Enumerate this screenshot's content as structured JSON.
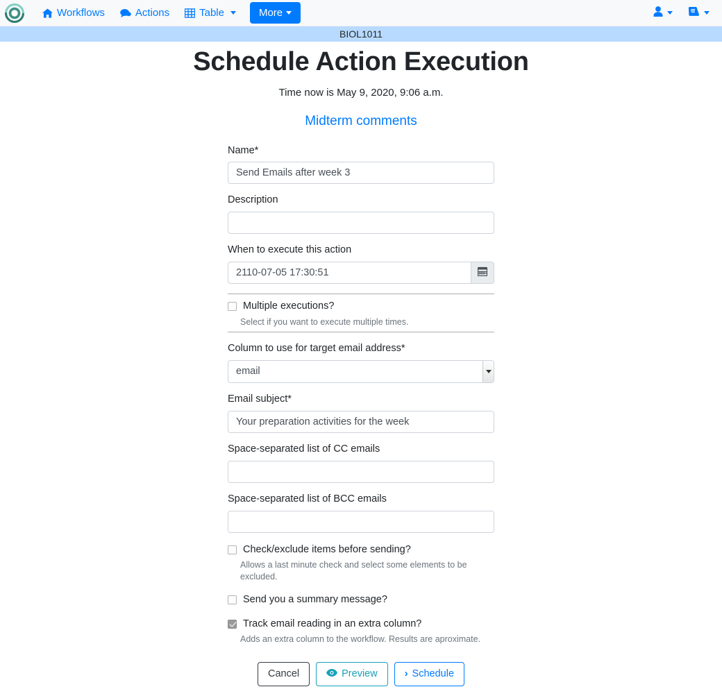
{
  "navbar": {
    "brand_icon": "ontask-logo-icon",
    "links": [
      {
        "label": "Workflows",
        "icon": "home-icon",
        "dropdown": false
      },
      {
        "label": "Actions",
        "icon": "comments-icon",
        "dropdown": false
      },
      {
        "label": "Table",
        "icon": "table-icon",
        "dropdown": true
      }
    ],
    "more_button": {
      "label": "More",
      "dropdown": true
    },
    "right_items": [
      {
        "icon": "user-icon",
        "dropdown": true
      },
      {
        "icon": "book-icon",
        "dropdown": true
      }
    ],
    "accent_color": "#007bff",
    "background_color": "#f8f9fa"
  },
  "course_bar": {
    "text": "BIOL1011",
    "background_color": "#b8daff"
  },
  "page": {
    "title": "Schedule Action Execution",
    "time_now": "Time now is May 9, 2020, 9:06 a.m.",
    "action_link": "Midterm comments"
  },
  "form": {
    "name": {
      "label": "Name*",
      "value": "Send Emails after week 3",
      "placeholder": ""
    },
    "description": {
      "label": "Description",
      "value": "",
      "placeholder": ""
    },
    "when": {
      "label": "When to execute this action",
      "value": "2110-07-05 17:30:51",
      "placeholder": "",
      "button_icon": "calendar-icon"
    },
    "multiple_executions": {
      "label": "Multiple executions?",
      "help": "Select if you want to execute multiple times.",
      "checked": false
    },
    "email_column": {
      "label": "Column to use for target email address*",
      "value": "email",
      "options": [
        "email"
      ]
    },
    "subject": {
      "label": "Email subject*",
      "value": "Your preparation activities for the week",
      "placeholder": ""
    },
    "cc": {
      "label": "Space-separated list of CC emails",
      "value": "",
      "placeholder": ""
    },
    "bcc": {
      "label": "Space-separated list of BCC emails",
      "value": "",
      "placeholder": ""
    },
    "checks": [
      {
        "label": "Check/exclude items before sending?",
        "help": "Allows a last minute check and select some elements to be excluded.",
        "checked": false
      },
      {
        "label": "Send you a summary message?",
        "help": "",
        "checked": false
      },
      {
        "label": "Track email reading in an extra column?",
        "help": "Adds an extra column to the workflow. Results are aproximate.",
        "checked": true
      }
    ],
    "buttons": {
      "cancel": "Cancel",
      "preview": "Preview",
      "preview_icon": "eye-icon",
      "schedule": "Schedule",
      "schedule_icon": "chevron-right-icon"
    }
  }
}
